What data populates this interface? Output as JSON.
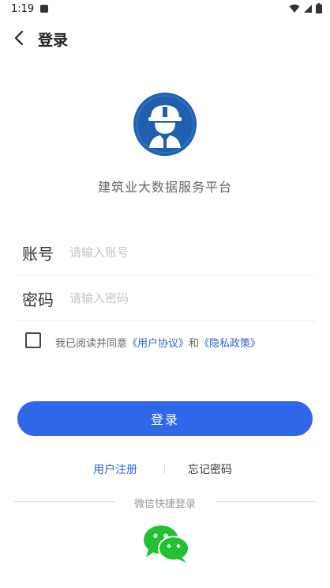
{
  "status_bar": {
    "time": "1:19"
  },
  "nav": {
    "title": "登录"
  },
  "app": {
    "name": "建筑业大数据服务平台"
  },
  "account": {
    "label": "账号",
    "placeholder": "请输入账号",
    "value": ""
  },
  "password": {
    "label": "密码",
    "placeholder": "请输入密码",
    "value": ""
  },
  "agreement": {
    "checked": false,
    "prefix": "我已阅读并同意",
    "user_agreement": "《用户协议》",
    "and": "和",
    "privacy_policy": "《隐私政策》"
  },
  "login_button": {
    "label": "登录"
  },
  "links": {
    "register": "用户注册",
    "separator": "|",
    "forgot": "忘记密码"
  },
  "quick_login": {
    "label": "微信快捷登录"
  },
  "colors": {
    "primary": "#2f67e8",
    "link": "#2a66d9",
    "wechat": "#21c230",
    "logo_bg": "#1f5fae"
  }
}
